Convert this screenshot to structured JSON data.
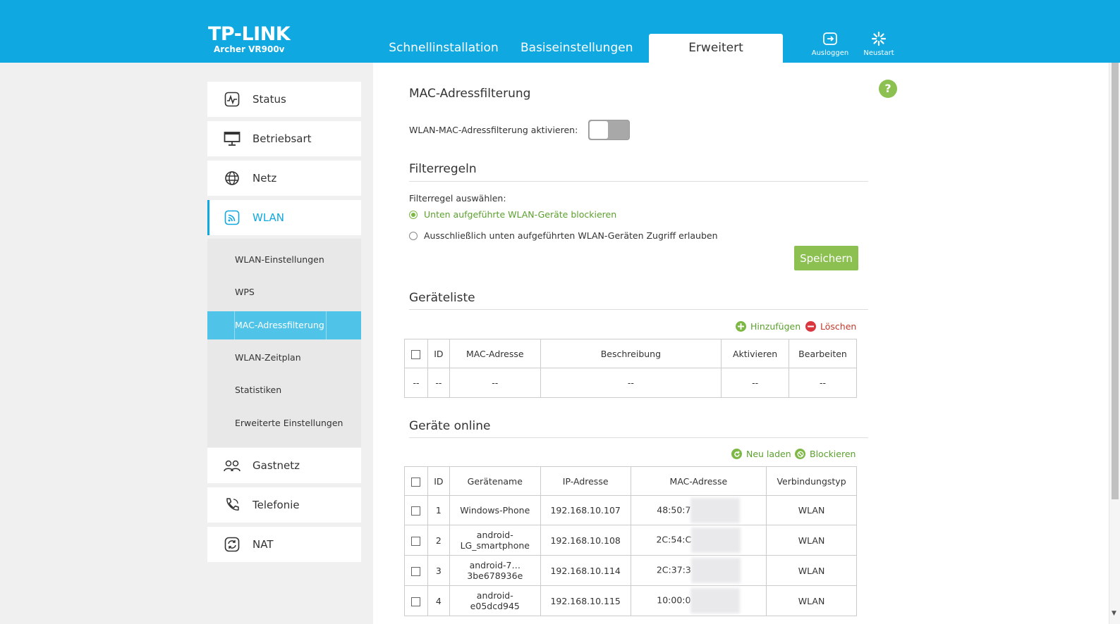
{
  "header": {
    "brand": "TP-LINK",
    "model": "Archer VR900v",
    "tabs": [
      "Schnellinstallation",
      "Basiseinstellungen",
      "Erweitert"
    ],
    "active_tab": "Erweitert",
    "logout_label": "Ausloggen",
    "reboot_label": "Neustart"
  },
  "sidebar": {
    "items": [
      {
        "label": "Status",
        "icon": "status-icon"
      },
      {
        "label": "Betriebsart",
        "icon": "monitor-icon"
      },
      {
        "label": "Netz",
        "icon": "globe-icon"
      },
      {
        "label": "WLAN",
        "icon": "wifi-icon"
      },
      {
        "label": "Gastnetz",
        "icon": "guests-icon"
      },
      {
        "label": "Telefonie",
        "icon": "phone-icon"
      },
      {
        "label": "NAT",
        "icon": "nat-icon"
      }
    ],
    "wlan_sub": [
      "WLAN-Einstellungen",
      "WPS",
      "MAC-Adressfilterung",
      "WLAN-Zeitplan",
      "Statistiken",
      "Erweiterte Einstellungen"
    ]
  },
  "page": {
    "title": "MAC-Adressfilterung",
    "enable_label": "WLAN-MAC-Adressfilterung aktivieren:",
    "filter_section": "Filterregeln",
    "filter_select_label": "Filterregel auswählen:",
    "option_block": "Unten aufgeführte WLAN-Geräte blockieren",
    "option_allow": "Ausschließlich unten aufgeführten WLAN-Geräten Zugriff erlauben",
    "save": "Speichern",
    "device_list_title": "Geräteliste",
    "add": "Hinzufügen",
    "delete": "Löschen",
    "device_cols": [
      "ID",
      "MAC-Adresse",
      "Beschreibung",
      "Aktivieren",
      "Bearbeiten"
    ],
    "device_empty": "--",
    "online_title": "Geräte online",
    "reload": "Neu laden",
    "block": "Blockieren",
    "online_cols": [
      "ID",
      "Gerätename",
      "IP-Adresse",
      "MAC-Adresse",
      "Verbindungstyp"
    ],
    "online_rows": [
      {
        "id": "1",
        "name": "Windows-Phone",
        "ip": "192.168.10.107",
        "mac": "48:50:7",
        "type": "WLAN"
      },
      {
        "id": "2",
        "name": "android-LG_smartphone",
        "ip": "192.168.10.108",
        "mac": "2C:54:C",
        "type": "WLAN"
      },
      {
        "id": "3",
        "name": "android-7…3be678936e",
        "ip": "192.168.10.114",
        "mac": "2C:37:3",
        "type": "WLAN"
      },
      {
        "id": "4",
        "name": "android-e05dcd945",
        "ip": "192.168.10.115",
        "mac": "10:00:0",
        "type": "WLAN"
      }
    ]
  },
  "colors": {
    "accent": "#10a8e0",
    "green": "#8cc152",
    "red": "#d9363e"
  }
}
